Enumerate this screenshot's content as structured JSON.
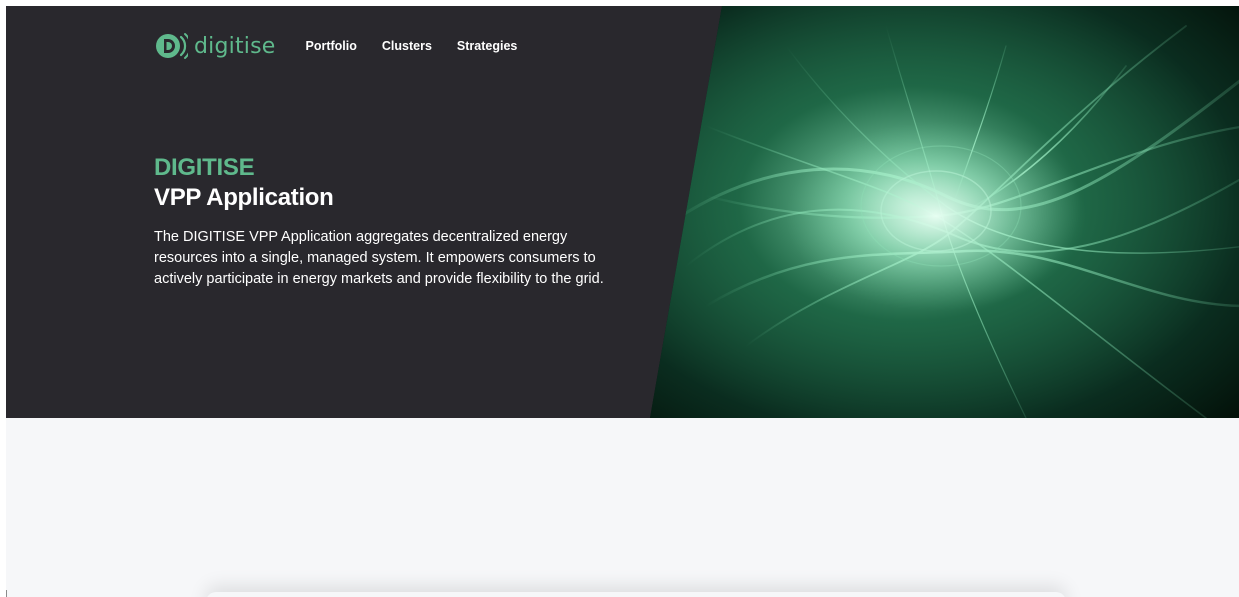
{
  "brand": {
    "name": "digitise",
    "accent_color": "#5fb98c",
    "icon": "digitise-logo-icon"
  },
  "nav": {
    "items": [
      {
        "label": "Portfolio"
      },
      {
        "label": "Clusters"
      },
      {
        "label": "Strategies"
      }
    ]
  },
  "hero": {
    "eyebrow": "DIGITISE",
    "title": "VPP Application",
    "description": "The DIGITISE VPP Application aggregates decentralized energy resources into a single, managed system. It empowers consumers to actively participate in energy markets and provide flexibility to the grid.",
    "background_color": "#29282d",
    "image": "green-energy-swirl-image"
  },
  "content": {
    "background_color": "#f6f7f9"
  }
}
